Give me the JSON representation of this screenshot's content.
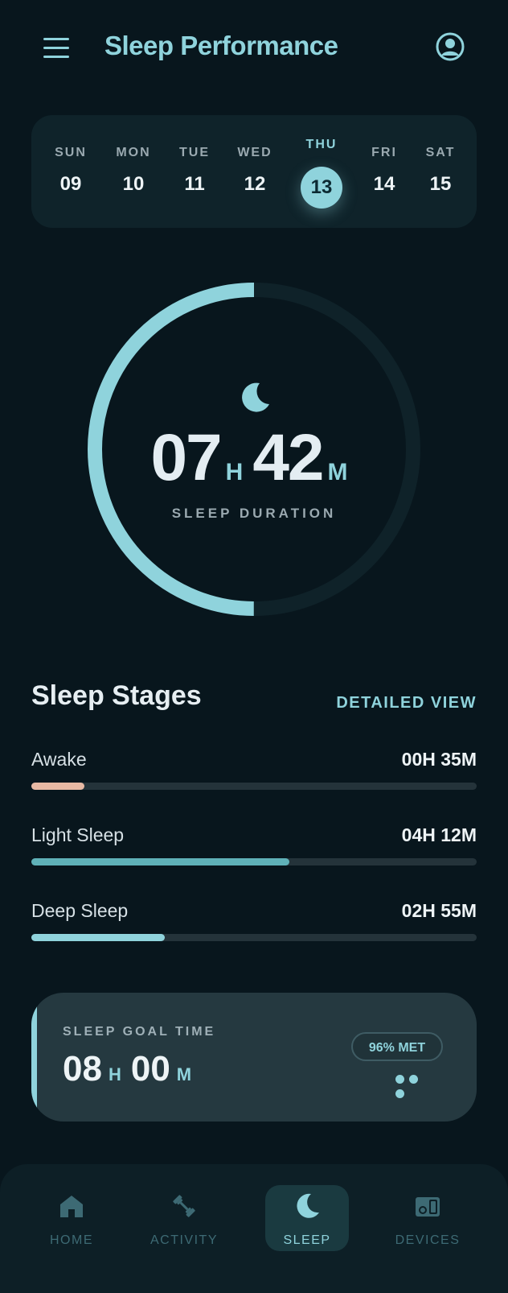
{
  "colors": {
    "background": "#08161d",
    "accent": "#8fd3dc",
    "awake": "#e8b9a4",
    "light_sleep": "#5fb1b8",
    "deep_sleep": "#8fd3dc",
    "ring_track": "#0f2229"
  },
  "header": {
    "title": "Sleep Performance",
    "menu_icon": "hamburger-menu-icon",
    "profile_icon": "user-circle-icon"
  },
  "week": {
    "days": [
      {
        "name": "SUN",
        "num": "09"
      },
      {
        "name": "MON",
        "num": "10"
      },
      {
        "name": "TUE",
        "num": "11"
      },
      {
        "name": "WED",
        "num": "12"
      },
      {
        "name": "THU",
        "num": "13"
      },
      {
        "name": "FRI",
        "num": "14"
      },
      {
        "name": "SAT",
        "num": "15"
      }
    ],
    "selected_index": 4
  },
  "summary": {
    "hours": "07",
    "hours_unit": "H",
    "minutes": "42",
    "minutes_unit": "M",
    "label": "SLEEP DURATION",
    "ring_progress": 0.5,
    "icon": "moon-icon"
  },
  "stages": {
    "title": "Sleep Stages",
    "link": "DETAILED VIEW",
    "items": [
      {
        "name": "Awake",
        "value": "00H 35M",
        "progress": 0.12
      },
      {
        "name": "Light Sleep",
        "value": "04H 12M",
        "progress": 0.58
      },
      {
        "name": "Deep Sleep",
        "value": "02H 55M",
        "progress": 0.3
      }
    ]
  },
  "goal": {
    "label": "SLEEP GOAL TIME",
    "hours": "08",
    "hours_unit": "H",
    "minutes": "00",
    "minutes_unit": "M",
    "badge": "96% MET"
  },
  "nav": {
    "items": [
      {
        "label": "HOME",
        "icon": "home-icon"
      },
      {
        "label": "ACTIVITY",
        "icon": "dumbbell-icon"
      },
      {
        "label": "SLEEP",
        "icon": "moon-icon"
      },
      {
        "label": "DEVICES",
        "icon": "devices-icon"
      }
    ],
    "active_index": 2
  }
}
